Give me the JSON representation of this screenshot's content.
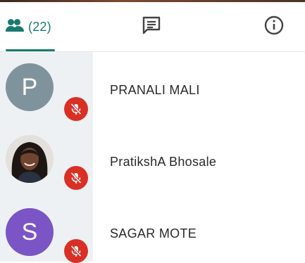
{
  "tabs": {
    "people": {
      "count_label": "(22)",
      "icon": "people-icon",
      "color": "#1a7a6e"
    },
    "chat": {
      "icon": "chat-icon"
    },
    "info": {
      "icon": "info-icon"
    }
  },
  "participants": [
    {
      "name": "PRANALI MALI",
      "initial": "P",
      "avatar_color": "#7f939c",
      "muted": true
    },
    {
      "name": "PratikshA Bhosale",
      "initial": "",
      "avatar_type": "photo",
      "muted": true
    },
    {
      "name": "SAGAR MOTE",
      "initial": "S",
      "avatar_color": "#7b55c5",
      "muted": true
    }
  ],
  "colors": {
    "mute_badge": "#d93025",
    "gutter": "#eef1f3"
  }
}
